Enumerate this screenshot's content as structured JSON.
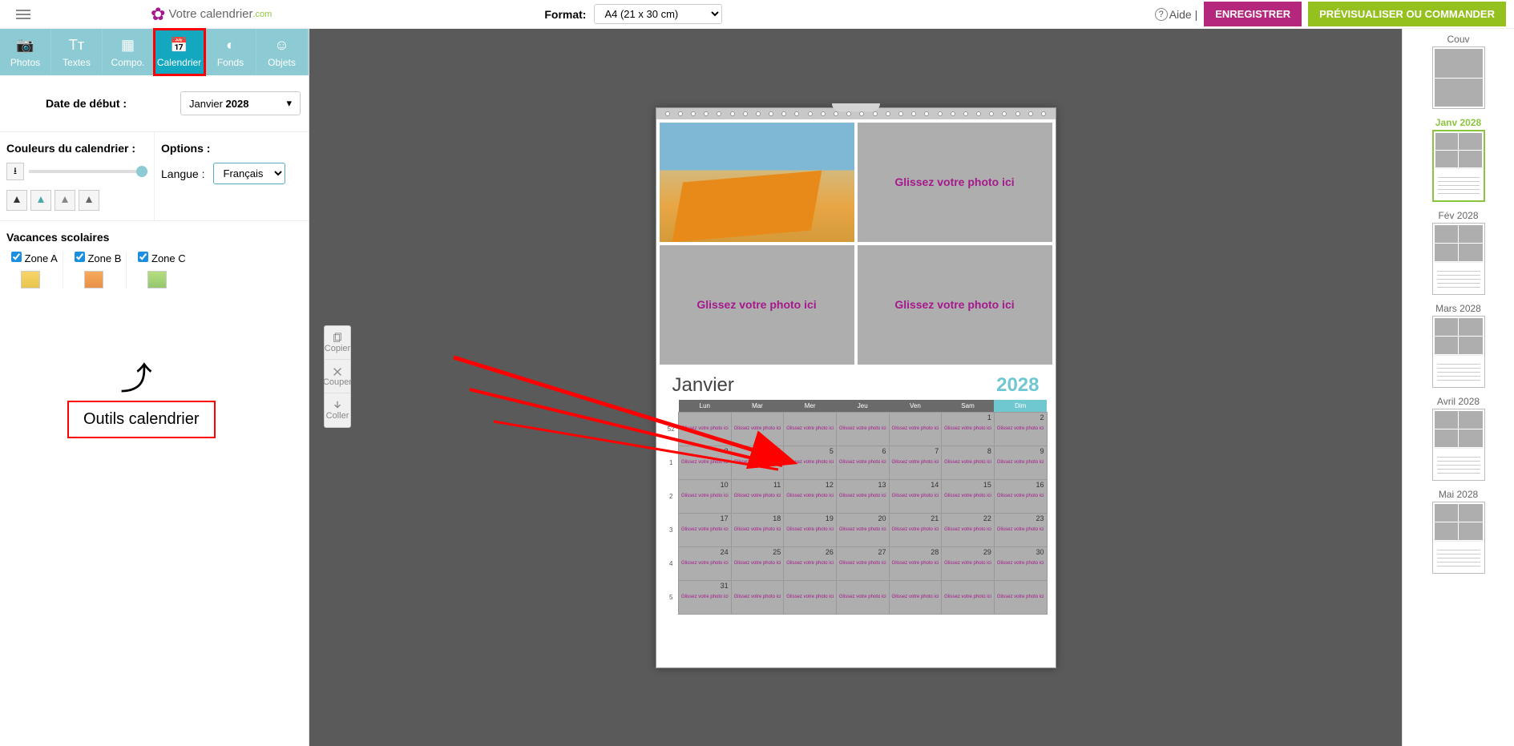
{
  "header": {
    "logo_main": "Votre calendrier",
    "logo_suffix": ".com",
    "format_label": "Format:",
    "format_value": "A4 (21 x 30 cm)",
    "aide": "Aide |",
    "save_btn": "ENREGISTRER",
    "preview_btn": "PRÉVISUALISER OU COMMANDER"
  },
  "tabs": {
    "photos": "Photos",
    "textes": "Textes",
    "compo": "Compo.",
    "calendrier": "Calendrier",
    "fonds": "Fonds",
    "objets": "Objets"
  },
  "panel": {
    "date_label": "Date de début :",
    "start_month": "Janvier",
    "start_year": "2028",
    "col_colors_title": "Couleurs du calendrier :",
    "col_options_title": "Options :",
    "lang_label": "Langue :",
    "lang_value": "Français",
    "vacances_title": "Vacances scolaires",
    "zone_a": "Zone A",
    "zone_b": "Zone B",
    "zone_c": "Zone C"
  },
  "annotation": {
    "label": "Outils calendrier"
  },
  "tools": {
    "copier": "Copier",
    "couper": "Couper",
    "coller": "Coller"
  },
  "calendar": {
    "month": "Janvier",
    "year": "2028",
    "drop_text": "Glissez votre photo ici",
    "cell_text": "Glissez votre photo ici",
    "days": [
      "Lun",
      "Mar",
      "Mer",
      "Jeu",
      "Ven",
      "Sam",
      "Dim"
    ],
    "weeks": [
      {
        "wk": "52",
        "d": [
          "",
          "",
          "",
          "",
          "",
          "1",
          "2"
        ]
      },
      {
        "wk": "1",
        "d": [
          "3",
          "4",
          "5",
          "6",
          "7",
          "8",
          "9"
        ]
      },
      {
        "wk": "2",
        "d": [
          "10",
          "11",
          "12",
          "13",
          "14",
          "15",
          "16"
        ]
      },
      {
        "wk": "3",
        "d": [
          "17",
          "18",
          "19",
          "20",
          "21",
          "22",
          "23"
        ]
      },
      {
        "wk": "4",
        "d": [
          "24",
          "25",
          "26",
          "27",
          "28",
          "29",
          "30"
        ]
      },
      {
        "wk": "5",
        "d": [
          "31",
          "",
          "",
          "",
          "",
          "",
          ""
        ]
      }
    ]
  },
  "thumbs": {
    "items": [
      {
        "label": "Couv",
        "sel": false,
        "cover": true
      },
      {
        "label": "Janv 2028",
        "sel": true
      },
      {
        "label": "Fév 2028",
        "sel": false
      },
      {
        "label": "Mars 2028",
        "sel": false
      },
      {
        "label": "Avril 2028",
        "sel": false
      },
      {
        "label": "Mai 2028",
        "sel": false
      }
    ]
  }
}
